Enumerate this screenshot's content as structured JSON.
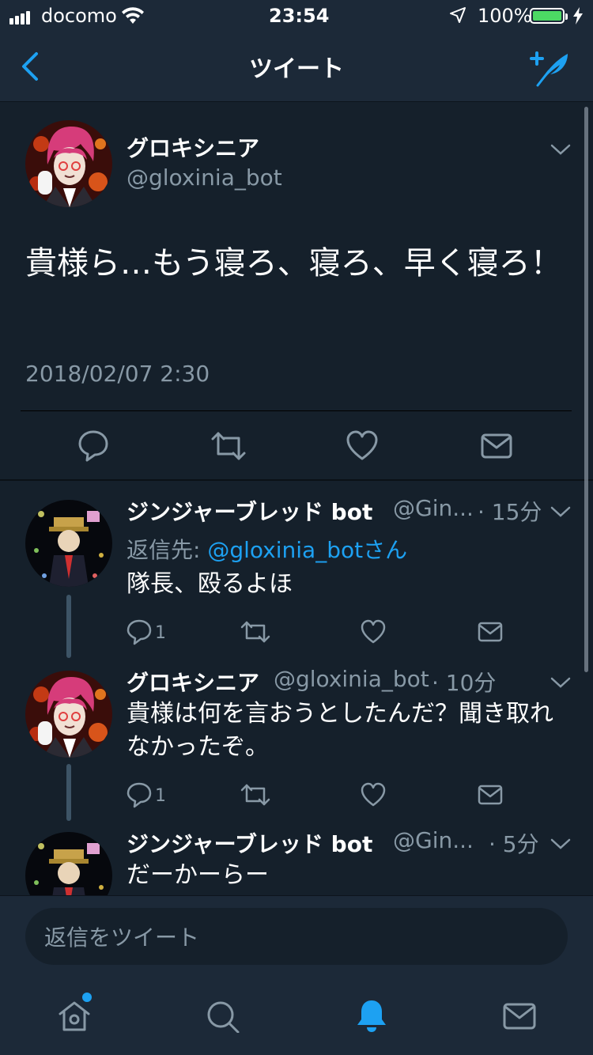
{
  "status_bar": {
    "carrier": "docomo",
    "time": "23:54",
    "battery_percent": "100%"
  },
  "nav": {
    "title": "ツイート",
    "back_icon": "chevron-left-icon",
    "compose_icon": "compose-tweet-icon"
  },
  "main_tweet": {
    "display_name": "グロキシニア",
    "handle": "@gloxinia_bot",
    "text": "貴様ら…もう寝ろ、寝ろ、早く寝ろ！",
    "timestamp": "2018/02/07 2:30"
  },
  "replies": [
    {
      "display_name": "ジンジャーブレッド bot",
      "handle": "@Gin...",
      "age": "· 15分",
      "reply_to_prefix": "返信先: ",
      "reply_to_user": "@gloxinia_botさん",
      "text": "隊長、殴るよほ",
      "reply_count": "1"
    },
    {
      "display_name": "グロキシニア",
      "handle": "@gloxinia_bot",
      "age": "· 10分",
      "text": "貴様は何を言おうとしたんだ？聞き取れなかったぞ。",
      "reply_count": "1"
    },
    {
      "display_name": "ジンジャーブレッド bot",
      "handle": "@Gin...",
      "age": "· 5分",
      "text": "だーかーらー"
    }
  ],
  "reply_bar": {
    "placeholder": "返信をツイート"
  },
  "tab_bar": {
    "tabs": [
      "home-icon",
      "search-icon",
      "notifications-icon",
      "messages-icon"
    ],
    "active": "notifications-icon",
    "accent": "#1da1f2"
  },
  "colors": {
    "background": "#15202b",
    "bar": "#1c2938",
    "accent": "#1da1f2",
    "secondary_text": "#8899a6"
  }
}
